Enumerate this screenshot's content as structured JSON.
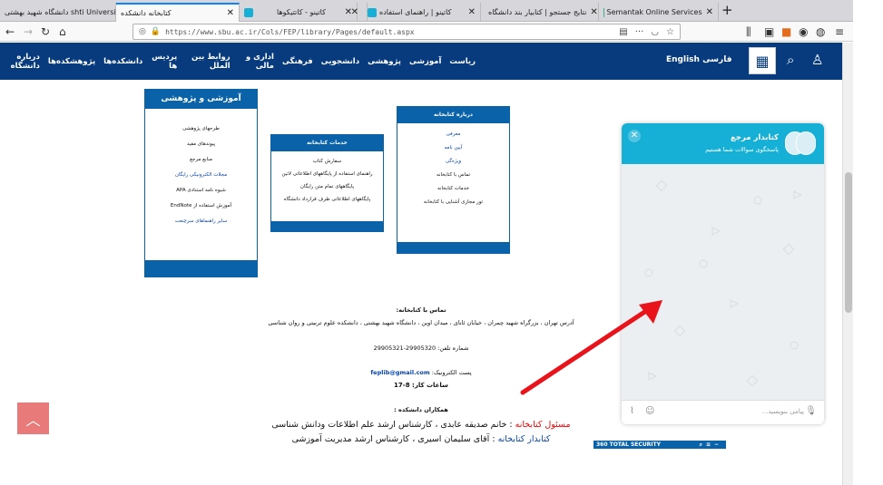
{
  "browser": {
    "tabs": [
      {
        "label": "دانشگاه شهید بهشتی shti University"
      },
      {
        "label": "کتابخانه دانشکده"
      },
      {
        "label": ""
      },
      {
        "label": "کاتینو - کاتتیکوها"
      },
      {
        "label": "کاتینو | راهنمای استفاده"
      },
      {
        "label": "نتایج جستجو | کتابیار بند دانشگاه"
      },
      {
        "label": "Semantak Online Services"
      }
    ],
    "url": "https://www.sbu.ac.ir/Cols/FEP/library/Pages/default.aspx"
  },
  "site": {
    "lang_en": "English",
    "lang_fa": "فارسی",
    "menu": [
      "ریاست",
      "آموزشی",
      "پژوهشی",
      "دانشجویی",
      "فرهنگی",
      "اداری و مالی",
      "روابط بین الملل",
      "پردیس ها",
      "دانشکده‌ها",
      "پژوهشکده‌ها",
      "درباره دانشگاه"
    ]
  },
  "boxes": {
    "research": {
      "title": "آموزشی و پژوهشی",
      "items": [
        {
          "text": "طرحهای پژوهشی",
          "link": false
        },
        {
          "text": "پیوندهای مفید",
          "link": false
        },
        {
          "text": "منابع مرجع",
          "link": false
        },
        {
          "text": "مجلات الکترونیکی رایگان",
          "link": true
        },
        {
          "text": "شیوه نامه استنادی APA",
          "link": false
        },
        {
          "text": "آموزش استفاده از EndNote",
          "link": false
        },
        {
          "text": "سایر راهنماهای سرچنعت",
          "link": true
        }
      ]
    },
    "services": {
      "title": "خدمات کتابخانه",
      "items": [
        {
          "text": "سفارش کتاب",
          "link": false
        },
        {
          "text": "راهنمای استفاده از پایگاههای اطلاعاتی لاتین",
          "link": false
        },
        {
          "text": "پایگاههای تمام متن رایگان",
          "link": false
        },
        {
          "text": "پایگاههای اطلاعاتی طرف قرارداد دانشگاه",
          "link": false
        }
      ]
    },
    "about": {
      "title": "درباره کتابخانه",
      "items": [
        {
          "text": "معرفی",
          "link": true
        },
        {
          "text": "آیین نامه",
          "link": true
        },
        {
          "text": "ویژه‌گی",
          "link": true
        },
        {
          "text": "تماس با کتابخانه",
          "link": false
        },
        {
          "text": "خدمات کتابخانه",
          "link": false
        },
        {
          "text": "تور مجازی آشنایی با کتابخانه",
          "link": false
        }
      ]
    }
  },
  "contact": {
    "heading": "تماس با کتابخانه:",
    "address": "آدرس تهران ، بزرگراه شهید چمران ، خیابان ئانای ، میدان اوین ، دانشگاه شهید بهشتی ، دانشکده علوم تربیتی و روان شناسی",
    "phone": "شماره تلفن: 29905320-29905321",
    "email_label": "پست الکترونیک:",
    "email": "feplib@gmail.com",
    "hours_label": "ساعات کار:",
    "hours": "8-17",
    "colleagues": "همکاران دانشکده :",
    "staff1_role": "مسئول کتابخانه",
    "staff1_text": ": خانم صدیقه عابدی ، کارشناس ارشد علم اطلاعات ودانش شناسی",
    "staff2_role": "کتابدار کتابخانه",
    "staff2_text": ": آقای سلیمان اسیری ، کارشناس ارشد مدیریت آموزشی"
  },
  "chat": {
    "title": "کتابدار مرجع",
    "subtitle": "پاسخگوی سوالات شما هستیم",
    "placeholder": "پیامی بنویسید..."
  },
  "security_bar": "360 TOTAL SECURITY",
  "colors": {
    "nav": "#073b7e",
    "box": "#0a62a8",
    "chat": "#16b0d6",
    "arrow": "#e8131b"
  }
}
